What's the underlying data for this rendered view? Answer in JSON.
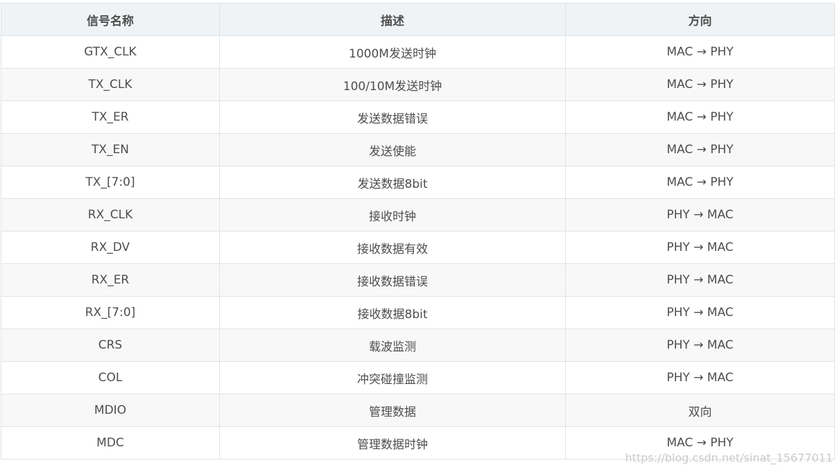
{
  "table": {
    "headers": [
      "信号名称",
      "描述",
      "方向"
    ],
    "rows": [
      [
        "GTX_CLK",
        "1000M发送时钟",
        "MAC → PHY"
      ],
      [
        "TX_CLK",
        "100/10M发送时钟",
        "MAC → PHY"
      ],
      [
        "TX_ER",
        "发送数据错误",
        "MAC → PHY"
      ],
      [
        "TX_EN",
        "发送使能",
        "MAC → PHY"
      ],
      [
        "TX_[7:0]",
        "发送数据8bit",
        "MAC → PHY"
      ],
      [
        "RX_CLK",
        "接收时钟",
        "PHY → MAC"
      ],
      [
        "RX_DV",
        "接收数据有效",
        "PHY → MAC"
      ],
      [
        "RX_ER",
        "接收数据错误",
        "PHY → MAC"
      ],
      [
        "RX_[7:0]",
        "接收数据8bit",
        "PHY → MAC"
      ],
      [
        "CRS",
        "载波监测",
        "PHY → MAC"
      ],
      [
        "COL",
        "冲突碰撞监测",
        "PHY → MAC"
      ],
      [
        "MDIO",
        "管理数据",
        "双向"
      ],
      [
        "MDC",
        "管理数据时钟",
        "MAC → PHY"
      ]
    ]
  },
  "watermark": "https://blog.csdn.net/sinat_15677011"
}
